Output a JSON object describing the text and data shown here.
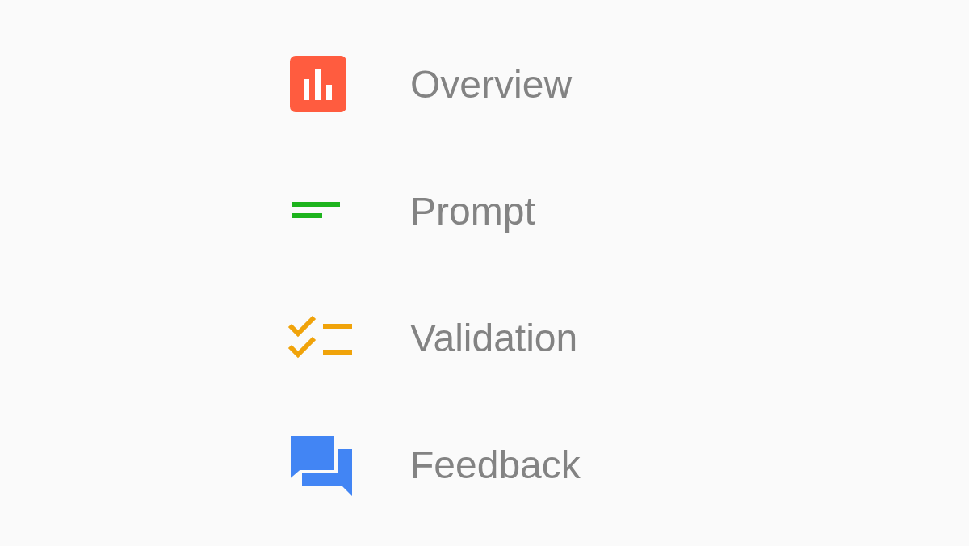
{
  "menu": {
    "items": [
      {
        "label": "Overview",
        "kind": "chart"
      },
      {
        "label": "Prompt",
        "kind": "lines"
      },
      {
        "label": "Validation",
        "kind": "checklist"
      },
      {
        "label": "Feedback",
        "kind": "chat"
      }
    ]
  }
}
